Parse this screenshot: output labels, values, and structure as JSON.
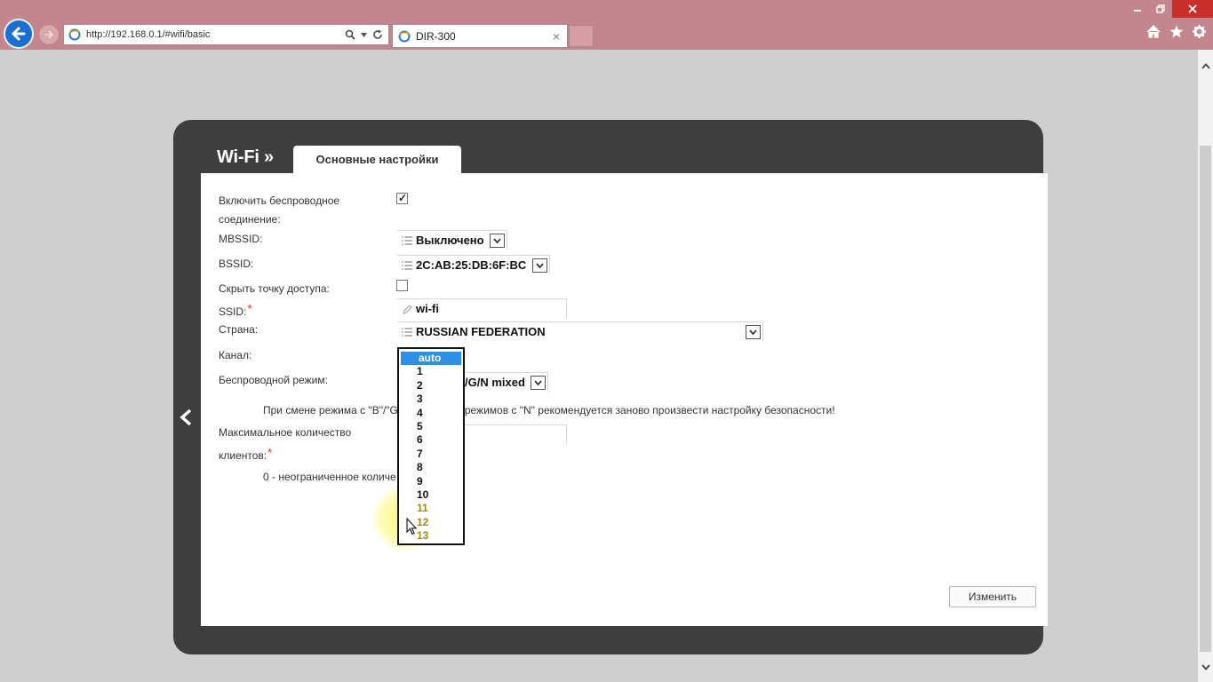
{
  "browser": {
    "url": "http://192.168.0.1/#wifi/basic",
    "tab_title": "DIR-300"
  },
  "panel": {
    "section_title": "Wi-Fi »",
    "active_tab": "Основные настройки"
  },
  "form": {
    "enable_wireless_label_1": "Включить беспроводное",
    "enable_wireless_label_2": "соединение:",
    "enable_wireless_checked": true,
    "mbssid_label": "MBSSID:",
    "mbssid_value": "Выключено",
    "bssid_label": "BSSID:",
    "bssid_value": "2C:AB:25:DB:6F:BC",
    "hide_ap_label": "Скрыть точку доступа:",
    "hide_ap_checked": false,
    "ssid_label": "SSID:",
    "ssid_required": "*",
    "ssid_value": "wi-fi",
    "country_label": "Страна:",
    "country_value": "RUSSIAN FEDERATION",
    "channel_label": "Канал:",
    "mode_label": "Беспроводной режим:",
    "mode_value_visible": "/G/N mixed",
    "mode_note_left": "При смене режима с \"B\"/\"G",
    "mode_note_right": "з режимов с \"N\" рекомендуется заново произвести настройку безопасности!",
    "max_clients_label_1": "Максимальное количество",
    "max_clients_label_2": "клиентов:",
    "max_clients_required": "*",
    "max_clients_note": "0 - неограниченное количе"
  },
  "channel_dropdown": {
    "options": [
      "auto",
      "1",
      "2",
      "3",
      "4",
      "5",
      "6",
      "7",
      "8",
      "9",
      "10",
      "11",
      "12",
      "13"
    ],
    "selected": "auto"
  },
  "buttons": {
    "change": "Изменить"
  },
  "colors": {
    "chrome_bg": "#c4868e",
    "panel_bg": "#3e3e3e",
    "selected_option": "#2d8fe6",
    "required": "#e02020"
  }
}
